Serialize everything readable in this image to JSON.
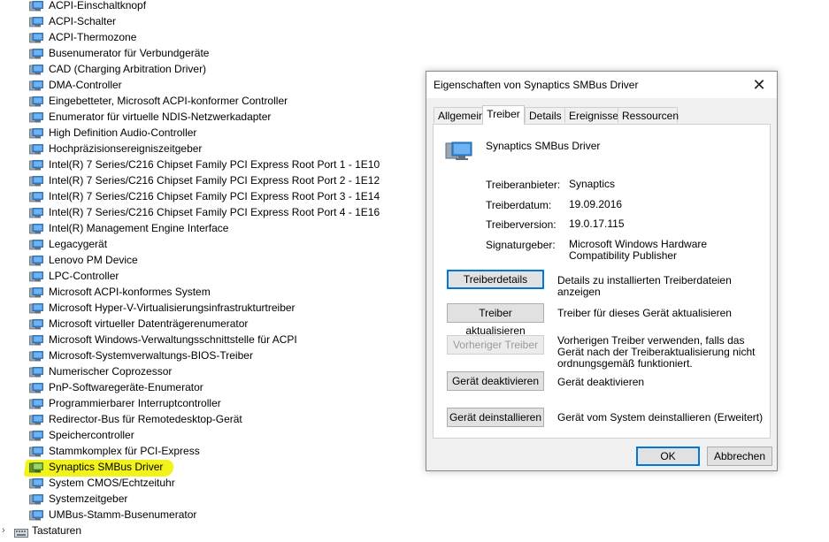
{
  "devices": [
    "ACPI-Einschaltknopf",
    "ACPI-Schalter",
    "ACPI-Thermozone",
    "Busenumerator für Verbundgeräte",
    "CAD (Charging Arbitration Driver)",
    "DMA-Controller",
    "Eingebetteter, Microsoft ACPI-konformer Controller",
    "Enumerator für virtuelle NDIS-Netzwerkadapter",
    "High Definition Audio-Controller",
    "Hochpräzisionsereigniszeitgeber",
    "Intel(R) 7 Series/C216 Chipset Family PCI Express Root Port 1 - 1E10",
    "Intel(R) 7 Series/C216 Chipset Family PCI Express Root Port 2 - 1E12",
    "Intel(R) 7 Series/C216 Chipset Family PCI Express Root Port 3 - 1E14",
    "Intel(R) 7 Series/C216 Chipset Family PCI Express Root Port 4 - 1E16",
    "Intel(R) Management Engine Interface",
    "Legacygerät",
    "Lenovo PM Device",
    "LPC-Controller",
    "Microsoft ACPI-konformes System",
    "Microsoft Hyper-V-Virtualisierungsinfrastrukturtreiber",
    "Microsoft virtueller Datenträgerenumerator",
    "Microsoft Windows-Verwaltungsschnittstelle für ACPI",
    "Microsoft-Systemverwaltungs-BIOS-Treiber",
    "Numerischer Coprozessor",
    "PnP-Softwaregeräte-Enumerator",
    "Programmierbarer Interruptcontroller",
    "Redirector-Bus für Remotedesktop-Gerät",
    "Speichercontroller",
    "Stammkomplex für PCI-Express",
    "Synaptics SMBus Driver",
    "System CMOS/Echtzeituhr",
    "Systemzeitgeber",
    "UMBus-Stamm-Busenumerator"
  ],
  "highlighted_index": 29,
  "device_icon": "device-icon",
  "category": {
    "label": "Tastaturen",
    "icon": "keyboard-icon",
    "chevron": "›"
  },
  "dialog": {
    "title": "Eigenschaften von Synaptics SMBus Driver",
    "close_glyph": "✕",
    "tabs": [
      "Allgemein",
      "Treiber",
      "Details",
      "Ereignisse",
      "Ressourcen"
    ],
    "active_tab": "Treiber",
    "driver_name": "Synaptics SMBus Driver",
    "info": {
      "provider_label": "Treiberanbieter:",
      "provider_value": "Synaptics",
      "date_label": "Treiberdatum:",
      "date_value": "19.09.2016",
      "version_label": "Treiberversion:",
      "version_value": "19.0.17.115",
      "signer_label": "Signaturgeber:",
      "signer_value": "Microsoft Windows Hardware Compatibility Publisher"
    },
    "actions": {
      "details_label": "Treiberdetails",
      "details_desc": "Details zu installierten Treiberdateien anzeigen",
      "update_label": "Treiber aktualisieren",
      "update_desc": "Treiber für dieses Gerät aktualisieren",
      "rollback_label": "Vorheriger Treiber",
      "rollback_desc": "Vorherigen Treiber verwenden, falls das Gerät nach der Treiberaktualisierung nicht ordnungsgemäß funktioniert.",
      "disable_label": "Gerät deaktivieren",
      "disable_desc": "Gerät deaktivieren",
      "uninstall_label": "Gerät deinstallieren",
      "uninstall_desc": "Gerät vom System deinstallieren (Erweitert)"
    },
    "ok_label": "OK",
    "cancel_label": "Abbrechen"
  },
  "colors": {
    "highlight": "#f3f31c",
    "focus": "#0078d7",
    "icon_blue": "#3c8ede"
  }
}
